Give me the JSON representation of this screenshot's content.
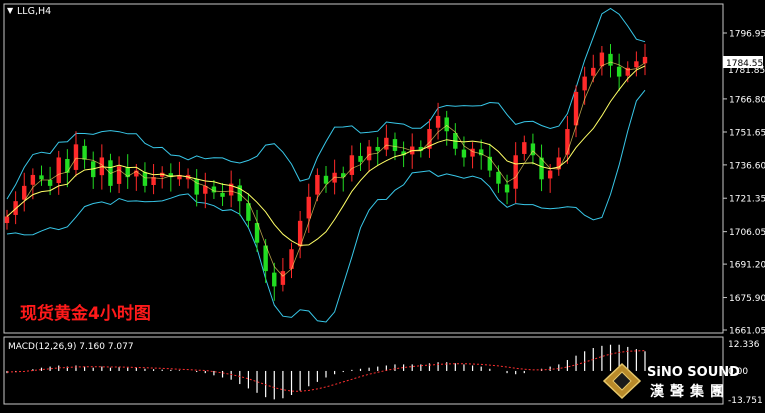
{
  "symbol_label": "LLG,H4",
  "panel_title": "现货黄金4小时图",
  "price_current": "1784.55",
  "price_overlap": "1781.85",
  "price_ticks": [
    "1796.95",
    "1781.85",
    "1766.80",
    "1751.65",
    "1736.60",
    "1721.35",
    "1706.05",
    "1691.20",
    "1675.90",
    "1661.05"
  ],
  "macd": {
    "label": "MACD(12,26,9) 7.160 7.077",
    "top_tick": "12.336",
    "zero_tick": "0.00",
    "bottom_tick": "-13.751"
  },
  "brand": {
    "name": "SiNO SOUND",
    "chinese": "漢聲集團"
  },
  "colors": {
    "background": "#000000",
    "up": "#ff2a2a",
    "down": "#22dd22",
    "bands": "#38c7e8",
    "ma": "#ffff66",
    "text": "#ffffff",
    "title_red": "#ff1a1a",
    "macd_hist": "#ffffff",
    "macd_signal": "#ff3030"
  },
  "chart_data": {
    "type": "candlestick",
    "symbol": "LLG",
    "timeframe": "H4",
    "ylim": [
      1661.05,
      1796.95
    ],
    "close": [
      1713,
      1720,
      1727,
      1732,
      1730,
      1727,
      1740,
      1733,
      1746,
      1739,
      1731,
      1740,
      1727,
      1736,
      1731,
      1734,
      1727,
      1731,
      1733,
      1731,
      1731,
      1731,
      1723,
      1727,
      1724,
      1722,
      1728,
      1720,
      1711,
      1701,
      1688,
      1681,
      1688,
      1698,
      1711,
      1722,
      1732,
      1728,
      1733,
      1731,
      1741,
      1738,
      1745,
      1743,
      1749,
      1743,
      1741,
      1745,
      1743,
      1753,
      1759,
      1752,
      1744,
      1740,
      1744,
      1741,
      1734,
      1728,
      1724,
      1741,
      1747,
      1741,
      1730,
      1734,
      1740,
      1753,
      1770,
      1777,
      1781,
      1788,
      1782,
      1777,
      1781,
      1784,
      1785
    ],
    "macd": [
      -1,
      -0.5,
      0,
      0.8,
      1.5,
      2,
      2.5,
      2,
      2.5,
      2,
      1.5,
      2,
      1.5,
      1.8,
      1.5,
      1.5,
      1,
      0.8,
      0.6,
      0.5,
      0.3,
      0,
      -0.5,
      -1,
      -2,
      -3,
      -4,
      -6,
      -8,
      -10,
      -12,
      -13,
      -12.5,
      -11,
      -9,
      -7,
      -5,
      -3,
      -1.5,
      -0.5,
      0.5,
      1,
      1.5,
      2,
      2.5,
      3,
      3,
      3,
      3,
      3.5,
      4,
      4,
      3.5,
      3,
      2.5,
      2,
      1,
      0,
      -1,
      -1.5,
      -1,
      0,
      1,
      2,
      3,
      5,
      7,
      9,
      10.5,
      11.5,
      12,
      12,
      11,
      10,
      9
    ],
    "macd_signal": [
      -0.5,
      -0.4,
      -0.2,
      0.2,
      0.6,
      1,
      1.4,
      1.6,
      1.8,
      1.9,
      1.9,
      1.9,
      1.8,
      1.8,
      1.7,
      1.6,
      1.5,
      1.3,
      1.2,
      1,
      0.8,
      0.6,
      0.4,
      0.2,
      -0.3,
      -0.9,
      -1.6,
      -2.5,
      -3.6,
      -4.9,
      -6.3,
      -7.6,
      -8.6,
      -9.2,
      -9.3,
      -8.9,
      -8.2,
      -7.3,
      -6.2,
      -5,
      -3.8,
      -2.6,
      -1.5,
      -0.6,
      0.3,
      1,
      1.6,
      2,
      2.4,
      2.7,
      3,
      3.2,
      3.3,
      3.3,
      3.2,
      3,
      2.7,
      2.3,
      1.8,
      1.2,
      0.8,
      0.5,
      0.5,
      0.7,
      1.1,
      1.8,
      2.8,
      4,
      5.3,
      6.6,
      7.7,
      8.5,
      9,
      9.2,
      9.3
    ]
  }
}
